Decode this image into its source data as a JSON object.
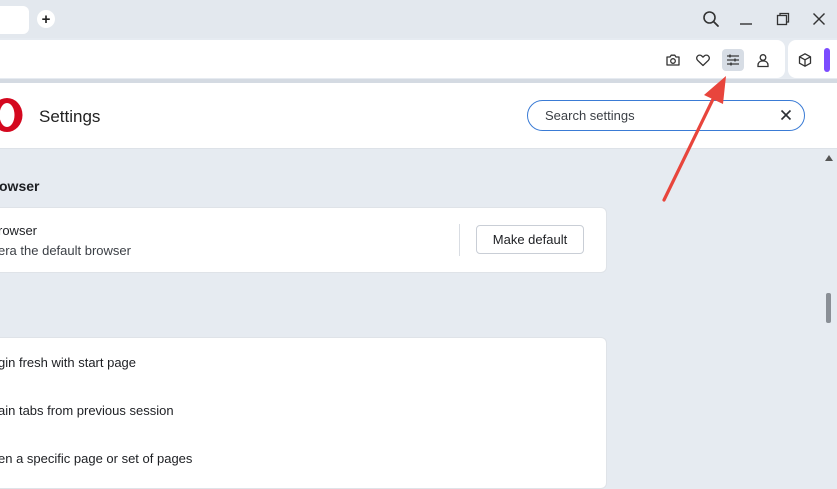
{
  "browser": {
    "new_tab_label": "+",
    "icons": {
      "search": "search-icon",
      "minimize": "minimize-icon",
      "restore": "restore-icon",
      "close": "close-icon",
      "snapshot": "camera-icon",
      "my_flow": "heart-icon",
      "easy_setup": "sliders-icon",
      "account": "profile-icon",
      "extensions": "cube-icon"
    },
    "accent_color": "#7b4bff"
  },
  "settings": {
    "title": "Settings",
    "search": {
      "value": "Search settings",
      "clear_icon": "close-icon",
      "border_color": "#3a7bd5"
    },
    "default_browser": {
      "section_title": "owser",
      "row_title": "rowser",
      "row_subtitle": "era the default browser",
      "button_label": "Make default"
    },
    "startup": {
      "options": [
        "gin fresh with start page",
        "ain tabs from previous session",
        "en a specific page or set of pages"
      ]
    }
  },
  "annotation": {
    "color": "#e8453c"
  }
}
